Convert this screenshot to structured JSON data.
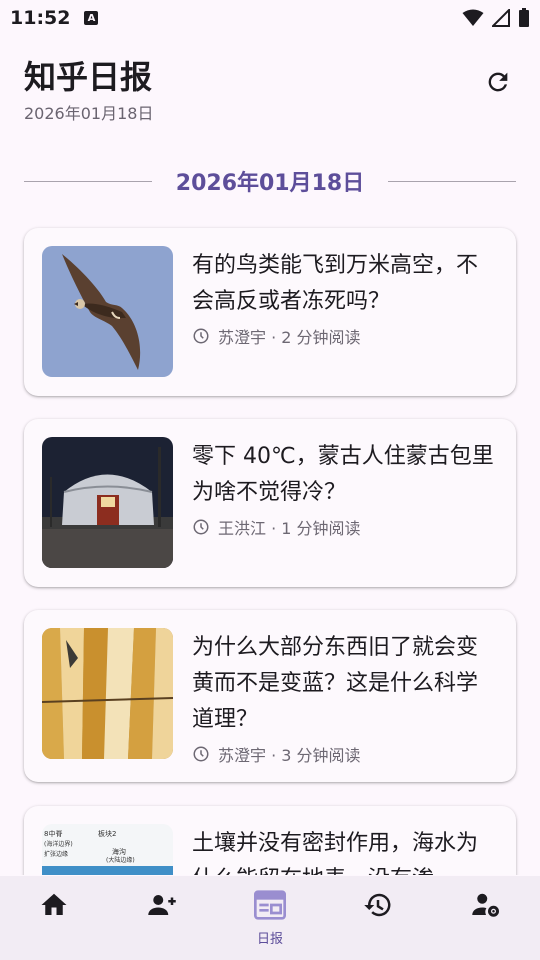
{
  "status_bar": {
    "time": "11:52",
    "notification_glyph": "A"
  },
  "header": {
    "title": "知乎日报",
    "subtitle": "2026年01月18日"
  },
  "date_divider": {
    "label": "2026年01月18日"
  },
  "stories": [
    {
      "title": "有的鸟类能飞到万米高空，不会高反或者冻死吗？",
      "meta": "苏澄宇 · 2 分钟阅读",
      "image": "vulture-flying-image"
    },
    {
      "title": "零下 40℃，蒙古人住蒙古包里为啥不觉得冷？",
      "meta": "王洪江 · 1 分钟阅读",
      "image": "yurt-night-image"
    },
    {
      "title": "为什么大部分东西旧了就会变黄而不是变蓝？这是什么科学道理？",
      "meta": "苏澄宇 · 3 分钟阅读",
      "image": "yellowed-boards-image"
    },
    {
      "title": "土壤并没有密封作用，海水为什么能留在地表，没有渗",
      "meta": "",
      "image": "ocean-diagram-image"
    }
  ],
  "diagram_labels": [
    "8中脊",
    "板块2",
    "海沟",
    "(大陆边缘)",
    "(海洋边界)",
    "扩张边缘"
  ],
  "bottom_nav": {
    "items": [
      {
        "icon": "home-icon",
        "label": ""
      },
      {
        "icon": "person-add-icon",
        "label": ""
      },
      {
        "icon": "newspaper-icon",
        "label": "日报",
        "active": true
      },
      {
        "icon": "history-icon",
        "label": ""
      },
      {
        "icon": "user-settings-icon",
        "label": ""
      }
    ]
  },
  "colors": {
    "accent": "#5d4e9a",
    "background": "#fdf7fd",
    "nav_background": "#f2ecf4",
    "active_nav": "#9a8ed0"
  }
}
